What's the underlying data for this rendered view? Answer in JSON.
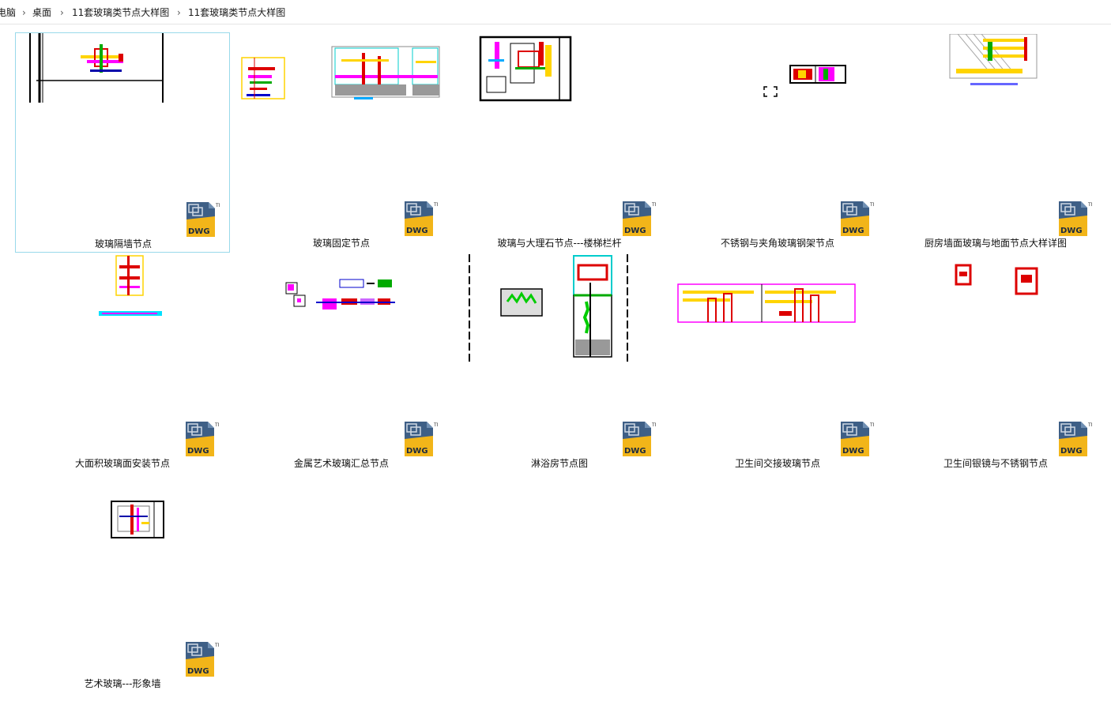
{
  "breadcrumb": {
    "items": [
      "电脑",
      "桌面",
      "11套玻璃类节点大样图",
      "11套玻璃类节点大样图"
    ],
    "separator": "›"
  },
  "files": [
    {
      "name": "玻璃隔墙节点",
      "type": "DWG",
      "selected": true
    },
    {
      "name": "玻璃固定节点",
      "type": "DWG"
    },
    {
      "name": "玻璃与大理石节点---楼梯栏杆",
      "type": "DWG"
    },
    {
      "name": "不锈钢与夹角玻璃钢架节点",
      "type": "DWG"
    },
    {
      "name": "厨房墙面玻璃与地面节点大样详图",
      "type": "DWG"
    },
    {
      "name": "大面积玻璃面安装节点",
      "type": "DWG"
    },
    {
      "name": "金属艺术玻璃汇总节点",
      "type": "DWG"
    },
    {
      "name": "淋浴房节点图",
      "type": "DWG"
    },
    {
      "name": "卫生间交接玻璃节点",
      "type": "DWG"
    },
    {
      "name": "卫生间银镜与不锈钢节点",
      "type": "DWG"
    },
    {
      "name": "艺术玻璃---形象墙",
      "type": "DWG"
    }
  ],
  "dwg_badge": {
    "text": "DWG",
    "tm": "TM",
    "accent": "#f2b519",
    "body": "#3e5f86"
  },
  "icons": [
    "chevron-right-icon",
    "dwg-file-icon"
  ],
  "colors": {
    "selection_border": "#99d9ea"
  }
}
